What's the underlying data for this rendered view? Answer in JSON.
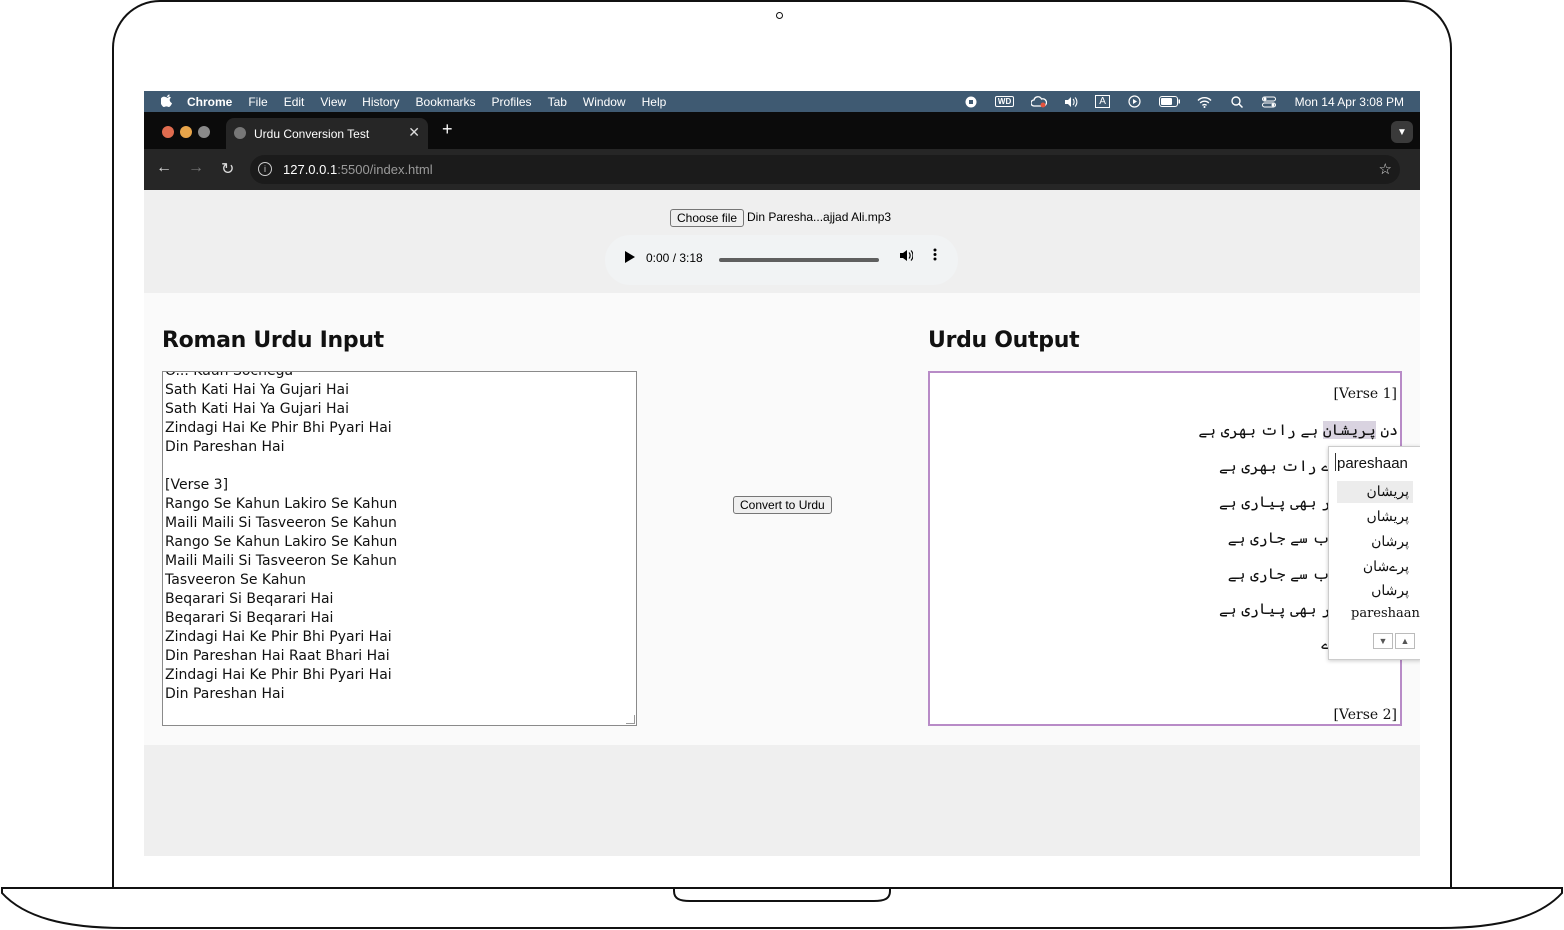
{
  "menubar": {
    "app": "Chrome",
    "items": [
      "File",
      "Edit",
      "View",
      "History",
      "Bookmarks",
      "Profiles",
      "Tab",
      "Window",
      "Help"
    ],
    "clock": "Mon 14 Apr  3:08 PM",
    "wd_label": "WD",
    "input_label": "A"
  },
  "tab": {
    "title": "Urdu Conversion Test"
  },
  "address": {
    "host": "127.0.0.1",
    "path": ":5500/index.html"
  },
  "file": {
    "button": "Choose file",
    "name": "Din Paresha...ajjad Ali.mp3"
  },
  "audio": {
    "time": "0:00 / 3:18"
  },
  "input_section": {
    "heading": "Roman Urdu Input",
    "lines": [
      "O... Kaun Sochega",
      "Sath Kati Hai Ya Gujari Hai",
      "Sath Kati Hai Ya Gujari Hai",
      "Zindagi Hai Ke Phir Bhi Pyari Hai",
      "Din Pareshan Hai",
      "",
      "[Verse 3]",
      "Rango Se Kahun Lakiro Se Kahun",
      "Maili Maili Si Tasveeron Se Kahun",
      "Rango Se Kahun Lakiro Se Kahun",
      "Maili Maili Si Tasveeron Se Kahun",
      "Tasveeron Se Kahun",
      "Beqarari Si Beqarari Hai",
      "Beqarari Si Beqarari Hai",
      "Zindagi Hai Ke Phir Bhi Pyari Hai",
      "Din Pareshan Hai Raat Bhari Hai",
      "Zindagi Hai Ke Phir Bhi Pyari Hai",
      "Din Pareshan Hai"
    ]
  },
  "convert_button": "Convert to Urdu",
  "output_section": {
    "heading": "Urdu Output",
    "verse_top": "[Verse 1]",
    "verse_bottom": "[Verse 2]",
    "line1_start": "دن ",
    "line1_highlight": "پریشان",
    "line1_end": " ہے رات بھری ہے",
    "line2": "ے رات بھری ہے",
    "line3": "ر بھی پیاری ہے",
    "line4": "ب سے جاری ہے",
    "line5": "ب سے جاری ہے",
    "line6": "ر بھی پیاری ہے",
    "line7": "ے"
  },
  "ime": {
    "query": "pareshaan",
    "candidates": [
      "پریشان",
      "پریشاں",
      "پرشان",
      "پرےشان",
      "پرشاں"
    ],
    "latin": "pareshaan"
  }
}
